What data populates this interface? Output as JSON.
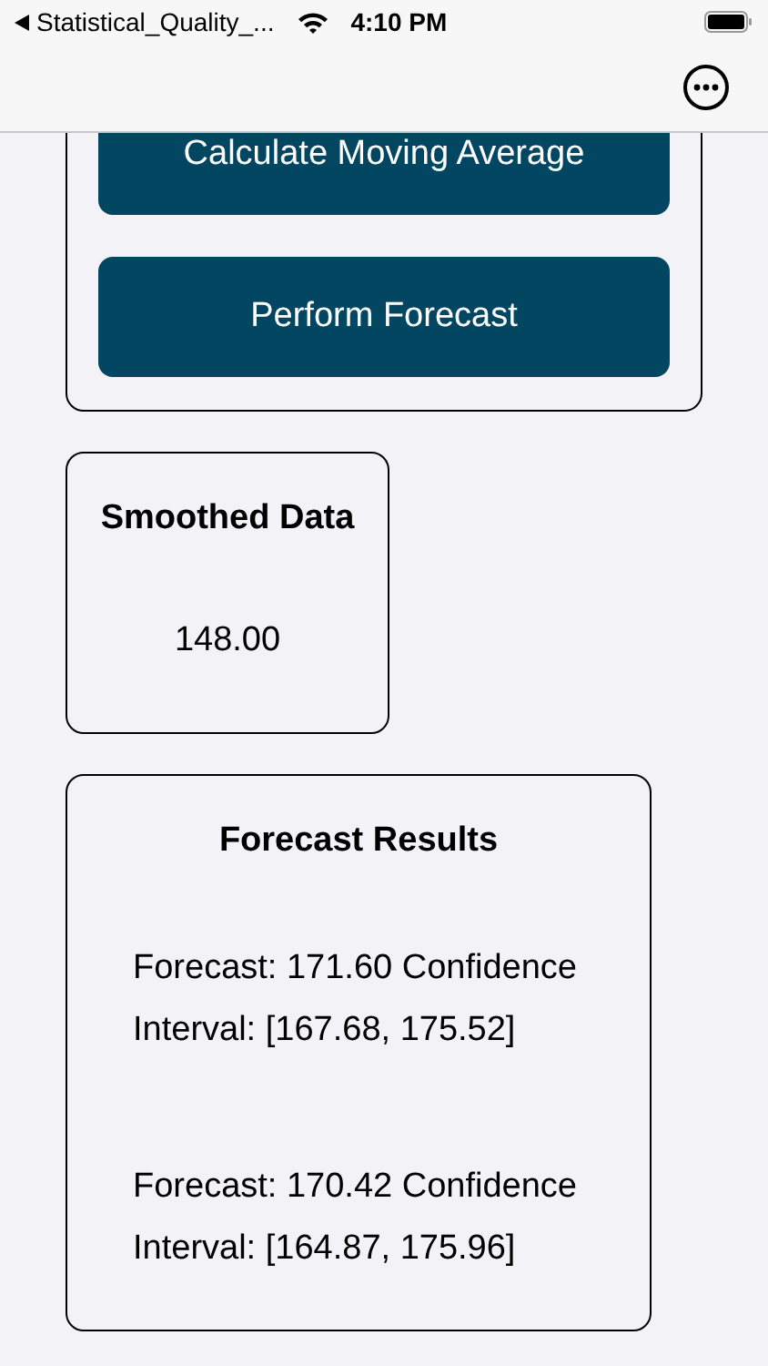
{
  "status_bar": {
    "back_app": "Statistical_Quality_...",
    "time": "4:10 PM"
  },
  "buttons": [
    "Calculate Moving Average",
    "Perform Forecast"
  ],
  "smoothed": {
    "title": "Smoothed Data",
    "value": "148.00"
  },
  "forecast": {
    "title": "Forecast Results",
    "results": [
      "Forecast: 171.60 Confidence Interval: [167.68, 175.52]",
      "Forecast: 170.42 Confidence Interval: [164.87, 175.96]"
    ]
  }
}
